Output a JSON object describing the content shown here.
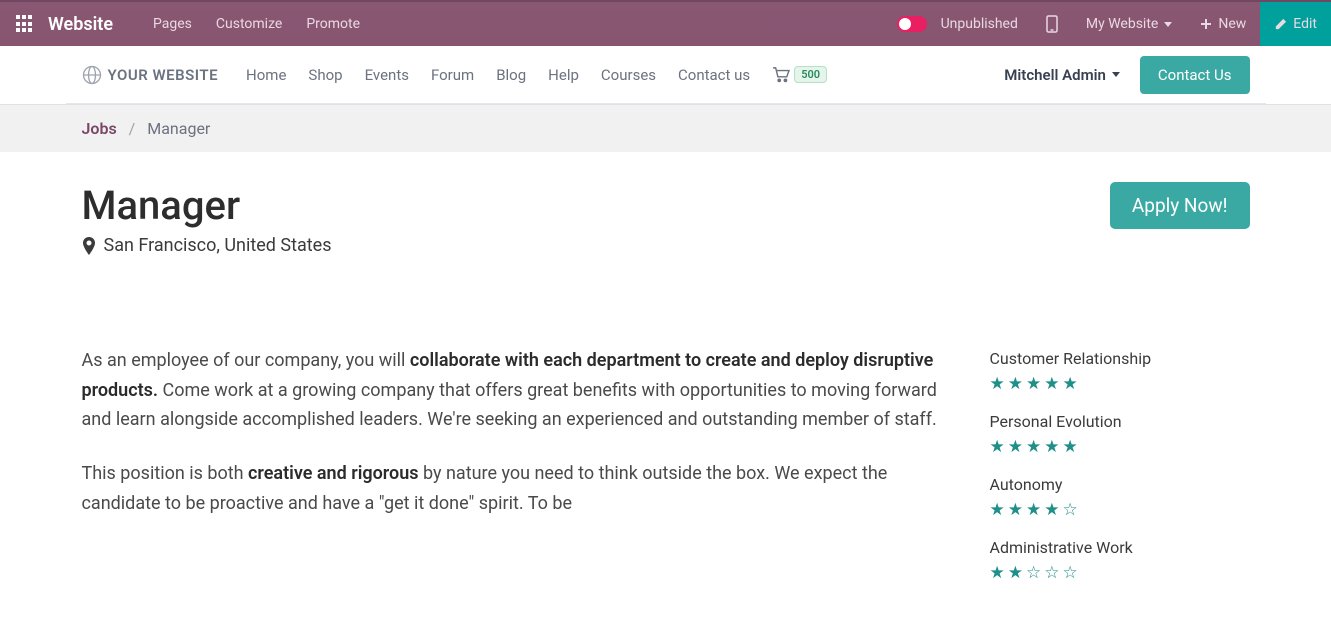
{
  "topbar": {
    "brand": "Website",
    "menu": [
      "Pages",
      "Customize",
      "Promote"
    ],
    "publish_label": "Unpublished",
    "my_website": "My Website",
    "new_label": "New",
    "edit_label": "Edit"
  },
  "sitebar": {
    "logo_text": "YOUR WEBSITE",
    "nav": [
      "Home",
      "Shop",
      "Events",
      "Forum",
      "Blog",
      "Help",
      "Courses",
      "Contact us"
    ],
    "cart_count": "500",
    "user_name": "Mitchell Admin",
    "contact_btn": "Contact Us"
  },
  "breadcrumb": {
    "parent": "Jobs",
    "current": "Manager"
  },
  "job": {
    "title": "Manager",
    "location": "San Francisco, United States",
    "apply_label": "Apply Now!",
    "p1_a": "As an employee of our company, you will ",
    "p1_bold": "collaborate with each department to create and deploy disruptive products.",
    "p1_b": " Come work at a growing company that offers great benefits with opportunities to moving forward and learn alongside accomplished leaders. We're seeking an experienced and outstanding member of staff.",
    "p2_a": "This position is both ",
    "p2_bold": "creative and rigorous",
    "p2_b": " by nature you need to think outside the box. We expect the candidate to be proactive and have a \"get it done\" spirit. To be"
  },
  "ratings": [
    {
      "label": "Customer Relationship",
      "score": 5
    },
    {
      "label": "Personal Evolution",
      "score": 5
    },
    {
      "label": "Autonomy",
      "score": 4
    },
    {
      "label": "Administrative Work",
      "score": 2
    }
  ]
}
